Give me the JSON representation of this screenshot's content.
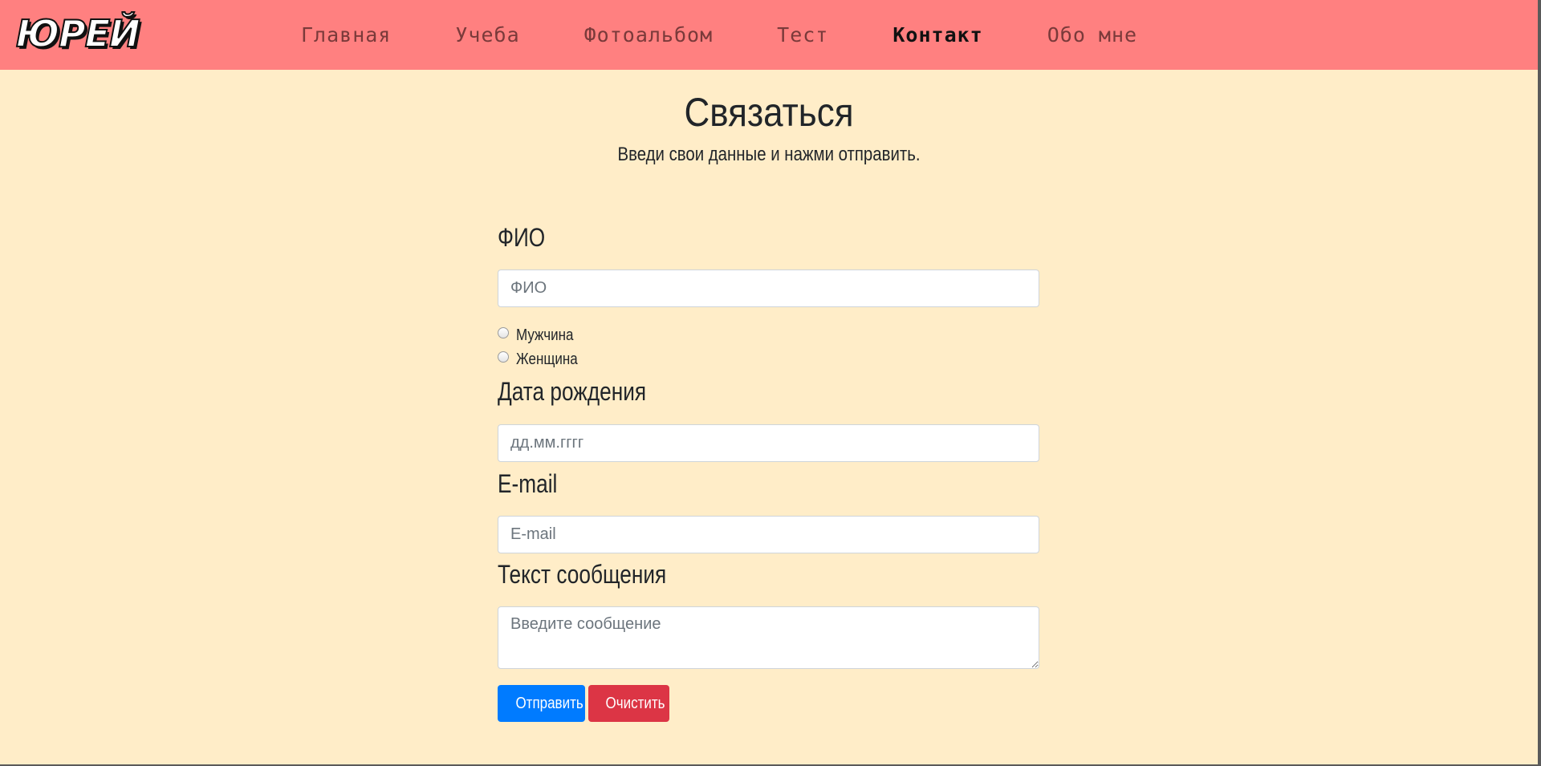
{
  "navbar": {
    "logo": "ЮРЕЙ",
    "links": [
      {
        "label": "Главная",
        "active": false
      },
      {
        "label": "Учеба",
        "active": false
      },
      {
        "label": "Фотоальбом",
        "active": false
      },
      {
        "label": "Тест",
        "active": false
      },
      {
        "label": "Контакт",
        "active": true
      },
      {
        "label": "Обо мне",
        "active": false
      }
    ],
    "background_color": "#ff8080"
  },
  "page": {
    "background_color": "#ffedc8",
    "heading": "Связаться",
    "subheading": "Введи свои данные и нажми отправить."
  },
  "form": {
    "name": {
      "label": "ФИО",
      "placeholder": "ФИО",
      "value": ""
    },
    "gender": {
      "options": [
        "Мужчина",
        "Женщина"
      ],
      "selected": null
    },
    "birthdate": {
      "label": "Дата рождения",
      "placeholder": "дд.мм.гггг"
    },
    "email": {
      "label": "E-mail",
      "placeholder": "E-mail",
      "value": ""
    },
    "message": {
      "label": "Текст сообщения",
      "placeholder": "Введите сообщение",
      "value": ""
    },
    "submit_label": "Отправить",
    "reset_label": "Очистить",
    "submit_color": "#007bff",
    "reset_color": "#dc3545"
  }
}
